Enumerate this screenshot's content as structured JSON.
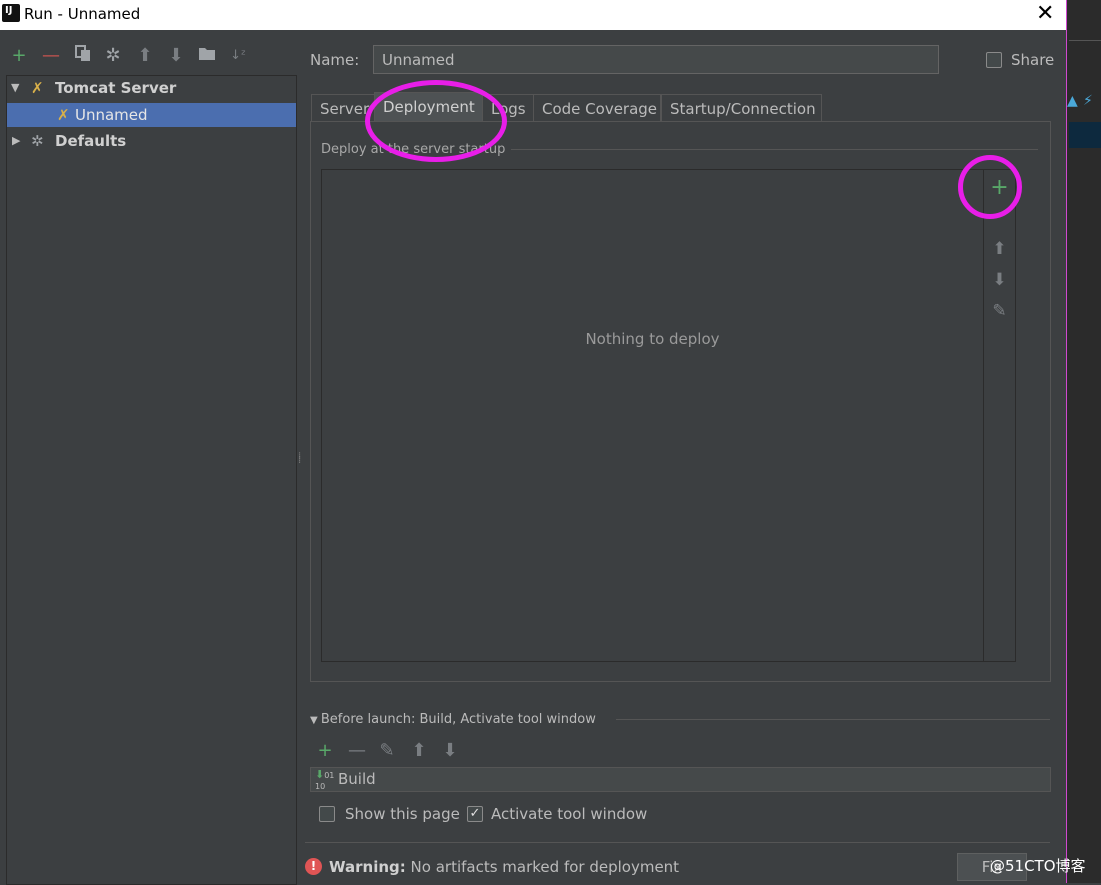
{
  "window": {
    "title": "Run - Unnamed",
    "app_icon_text": "IJ"
  },
  "colors": {
    "accent_selection": "#4b6eaf",
    "annotation_ring": "#e81ee8",
    "add_green": "#59a869",
    "remove_red": "#c75450",
    "warning_red": "#e05555"
  },
  "sidebar": {
    "toolbar_icons": [
      "add-icon",
      "remove-icon",
      "copy-icon",
      "wrench-icon",
      "arrow-up-icon",
      "arrow-down-icon",
      "folder-icon",
      "sort-icon"
    ],
    "tree": [
      {
        "label": "Tomcat Server",
        "expanded": true,
        "icon": "tomcat-icon"
      },
      {
        "label": "Unnamed",
        "selected": true,
        "icon": "tomcat-icon"
      },
      {
        "label": "Defaults",
        "expanded": false,
        "icon": "wrench-icon"
      }
    ]
  },
  "form": {
    "name_label": "Name:",
    "name_value": "Unnamed",
    "share_label": "Share",
    "share_checked": false
  },
  "tabs": [
    {
      "label": "Server",
      "active": false
    },
    {
      "label": "Deployment",
      "active": true
    },
    {
      "label": "Logs",
      "active": false
    },
    {
      "label": "Code Coverage",
      "active": false
    },
    {
      "label": "Startup/Connection",
      "active": false
    }
  ],
  "deployment": {
    "section_title": "Deploy at the server startup",
    "empty_text": "Nothing to deploy",
    "side_tools": [
      "add-icon",
      "arrow-up-icon",
      "arrow-down-icon",
      "edit-icon"
    ]
  },
  "before_launch": {
    "header": "Before launch: Build, Activate tool window",
    "tools": [
      "add-icon",
      "remove-icon",
      "edit-icon",
      "arrow-up-icon",
      "arrow-down-icon"
    ],
    "items": [
      {
        "label": "Build",
        "icon": "build-icon"
      }
    ],
    "show_this_page_label": "Show this page",
    "show_this_page_checked": false,
    "activate_tool_window_label": "Activate tool window",
    "activate_tool_window_checked": true
  },
  "warning": {
    "bold": "Warning:",
    "text": "No artifacts marked for deployment",
    "fix_label": "Fix"
  },
  "watermark": "@51CTO博客"
}
